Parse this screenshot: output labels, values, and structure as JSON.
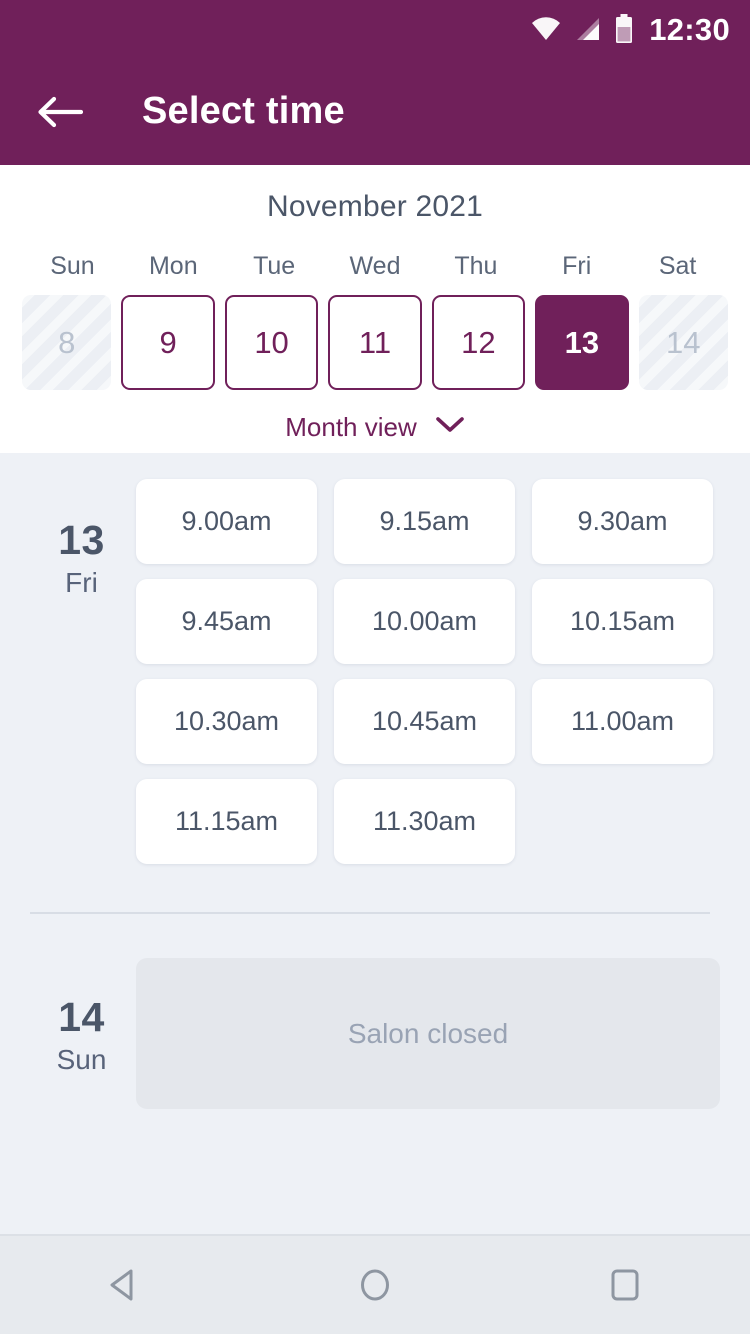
{
  "status_bar": {
    "time": "12:30",
    "icons": [
      "wifi-icon",
      "signal-icon",
      "battery-icon"
    ]
  },
  "app_bar": {
    "back_icon": "back-arrow-icon",
    "title": "Select time"
  },
  "calendar": {
    "month_title": "November 2021",
    "weekdays": [
      "Sun",
      "Mon",
      "Tue",
      "Wed",
      "Thu",
      "Fri",
      "Sat"
    ],
    "days": [
      {
        "num": "8",
        "state": "disabled"
      },
      {
        "num": "9",
        "state": "available"
      },
      {
        "num": "10",
        "state": "available"
      },
      {
        "num": "11",
        "state": "available"
      },
      {
        "num": "12",
        "state": "available"
      },
      {
        "num": "13",
        "state": "selected"
      },
      {
        "num": "14",
        "state": "disabled"
      }
    ],
    "month_view_label": "Month view",
    "month_view_icon": "chevron-down-icon"
  },
  "schedule": [
    {
      "day_number": "13",
      "day_name": "Fri",
      "slots": [
        "9.00am",
        "9.15am",
        "9.30am",
        "9.45am",
        "10.00am",
        "10.15am",
        "10.30am",
        "10.45am",
        "11.00am",
        "11.15am",
        "11.30am"
      ]
    },
    {
      "day_number": "14",
      "day_name": "Sun",
      "closed_message": "Salon closed"
    }
  ],
  "nav_bar": {
    "back_label": "back-triangle-icon",
    "home_label": "home-circle-icon",
    "recents_label": "recents-square-icon"
  },
  "colors": {
    "brand_purple": "#70205a",
    "text_slate": "#4b5668",
    "page_bg": "#eef1f6",
    "closed_bg": "#e4e7ec",
    "muted_text": "#99a3b4"
  }
}
